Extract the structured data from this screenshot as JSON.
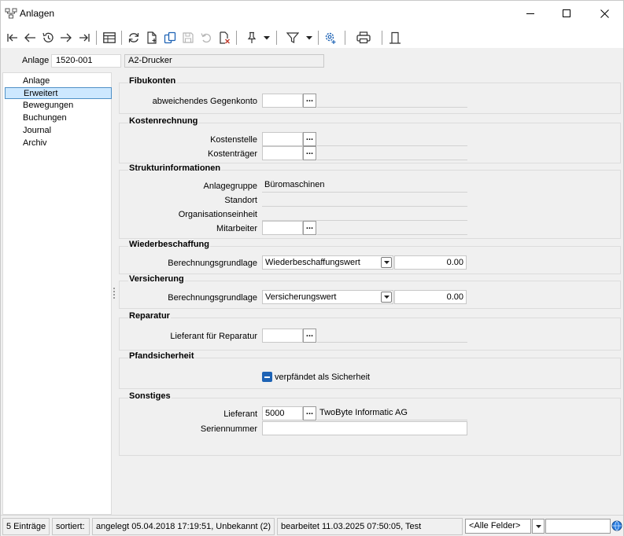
{
  "window": {
    "title": "Anlagen"
  },
  "header": {
    "anlage_label": "Anlage",
    "anlage_id": "1520-001",
    "anlage_name": "A2-Drucker"
  },
  "nav": {
    "items": [
      "Anlage",
      "Erweitert",
      "Bewegungen",
      "Buchungen",
      "Journal",
      "Archiv"
    ],
    "active": "Erweitert"
  },
  "sections": {
    "fibukonten": {
      "title": "Fibukonten",
      "gegenkonto_label": "abweichendes Gegenkonto",
      "gegenkonto_value": "",
      "gegenkonto_desc": ""
    },
    "kostenrechnung": {
      "title": "Kostenrechnung",
      "kostenstelle_label": "Kostenstelle",
      "kostentraeger_label": "Kostenträger"
    },
    "struktur": {
      "title": "Strukturinformationen",
      "anlagegruppe_label": "Anlagegruppe",
      "anlagegruppe_value": "Büromaschinen",
      "standort_label": "Standort",
      "orgeinheit_label": "Organisationseinheit",
      "mitarbeiter_label": "Mitarbeiter"
    },
    "wiederbeschaffung": {
      "title": "Wiederbeschaffung",
      "grundlage_label": "Berechnungsgrundlage",
      "grundlage_value": "Wiederbeschaffungswert",
      "amount": "0.00"
    },
    "versicherung": {
      "title": "Versicherung",
      "grundlage_label": "Berechnungsgrundlage",
      "grundlage_value": "Versicherungswert",
      "amount": "0.00"
    },
    "reparatur": {
      "title": "Reparatur",
      "lieferant_label": "Lieferant für Reparatur"
    },
    "pfand": {
      "title": "Pfandsicherheit",
      "checkbox_label": "verpfändet als Sicherheit"
    },
    "sonstiges": {
      "title": "Sonstiges",
      "lieferant_label": "Lieferant",
      "lieferant_value": "5000",
      "lieferant_name": "TwoByte Informatic AG",
      "serien_label": "Seriennummer",
      "serien_value": ""
    }
  },
  "dots_label": "...",
  "status": {
    "count": "5 Einträge",
    "sorted": "sortiert:",
    "created": "angelegt 05.04.2018 17:19:51, Unbekannt (2)",
    "edited": "bearbeitet 11.03.2025 07:50:05, Test",
    "filter_value": "<Alle Felder>",
    "search_placeholder": ""
  },
  "colors": {
    "accent": "#1e63b5",
    "selection": "#cde8ff",
    "panel": "#f0f0f0"
  }
}
